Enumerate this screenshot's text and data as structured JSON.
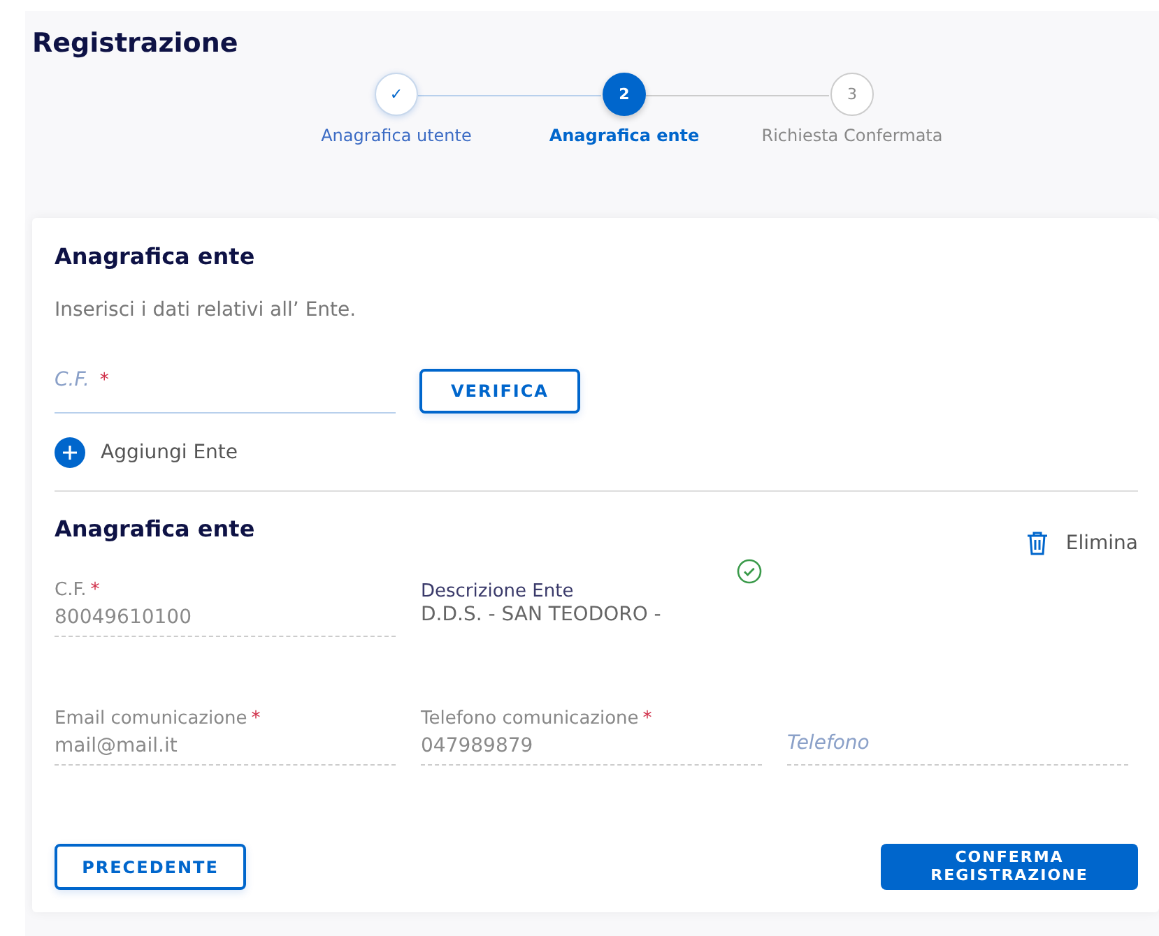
{
  "page": {
    "title": "Registrazione"
  },
  "steps": [
    {
      "marker": "✓",
      "label": "Anagrafica utente",
      "done": true,
      "selected": false
    },
    {
      "marker": "2",
      "label": "Anagrafica ente",
      "done": false,
      "selected": true
    },
    {
      "marker": "3",
      "label": "Richiesta Confermata",
      "done": false,
      "selected": false
    }
  ],
  "form": {
    "title": "Anagrafica ente",
    "description": "Inserisci i dati relativi all’ Ente.",
    "cf_field": {
      "placeholder": "C.F.",
      "required_mark": "*"
    },
    "verify_button": "VERIFICA",
    "add_button": "Aggiungi Ente"
  },
  "entity": {
    "title": "Anagrafica ente",
    "delete_button": "Elimina",
    "fields": [
      {
        "kind": "readonly",
        "label": "C.F.",
        "required_mark": "*",
        "value": "80049610100"
      },
      {
        "kind": "info",
        "label": "Descrizione Ente",
        "value": "D.D.S. - SAN TEODORO -",
        "verified": true
      },
      {
        "kind": "empty"
      },
      {
        "kind": "readonly",
        "label": "Email comunicazione",
        "required_mark": "*",
        "value": "mail@mail.it"
      },
      {
        "kind": "readonly",
        "label": "Telefono comunicazione",
        "required_mark": "*",
        "value": "047989879"
      },
      {
        "kind": "input",
        "placeholder": "Telefono"
      }
    ]
  },
  "buttons": {
    "back": "PRECEDENTE",
    "confirm": "CONFERMA REGISTRAZIONE"
  }
}
